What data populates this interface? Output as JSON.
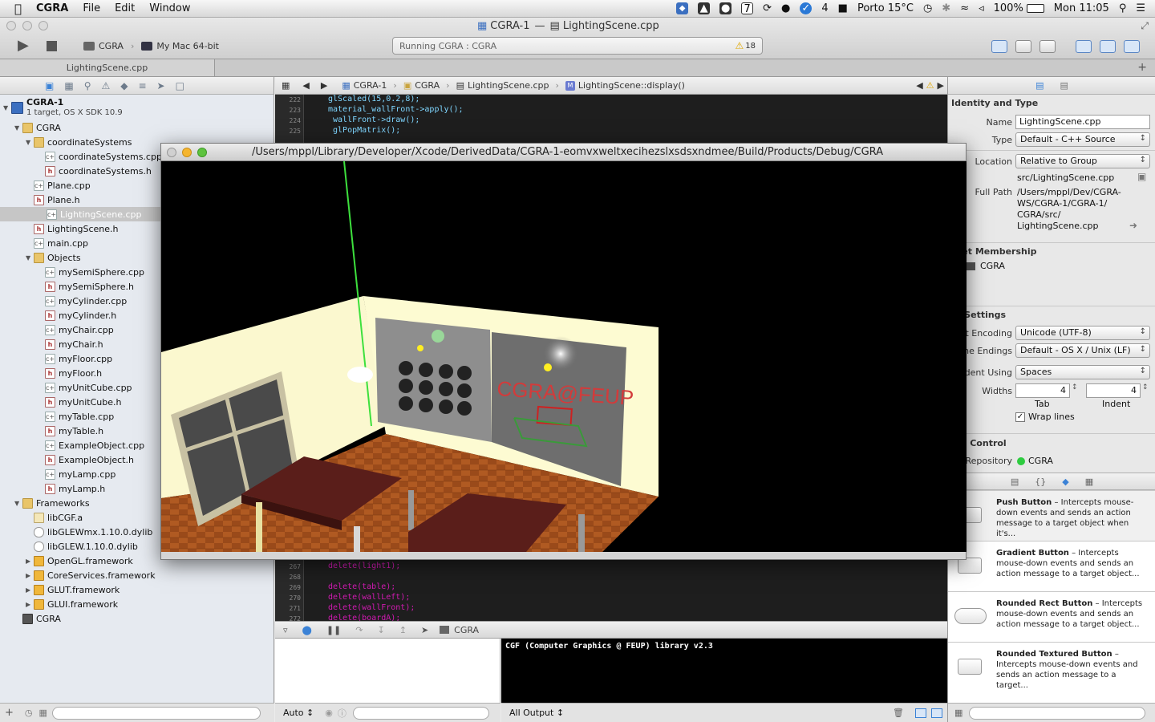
{
  "menubar": {
    "app_name": "CGRA",
    "menus": [
      "File",
      "Edit",
      "Window"
    ],
    "status_items": [
      "4",
      "Porto 15°C",
      "100%",
      "Mon 11:05"
    ]
  },
  "toolbar": {
    "scheme": "CGRA",
    "destination": "My Mac 64-bit",
    "status_text": "Running CGRA : CGRA",
    "warning_count": "18",
    "window_title_project": "CGRA-1",
    "window_title_sep": "—",
    "window_title_file": "LightingScene.cpp"
  },
  "tab": {
    "label": "LightingScene.cpp"
  },
  "navigator": {
    "project_name": "CGRA-1",
    "project_sub": "1 target, OS X SDK 10.9",
    "items": [
      {
        "label": "CGRA",
        "icon": "folder"
      },
      {
        "label": "coordinateSystems",
        "icon": "folder"
      },
      {
        "label": "coordinateSystems.cpp",
        "icon": "cpp"
      },
      {
        "label": "coordinateSystems.h",
        "icon": "h"
      },
      {
        "label": "Plane.cpp",
        "icon": "cpp"
      },
      {
        "label": "Plane.h",
        "icon": "h"
      },
      {
        "label": "LightingScene.cpp",
        "icon": "cpp"
      },
      {
        "label": "LightingScene.h",
        "icon": "h"
      },
      {
        "label": "main.cpp",
        "icon": "cpp"
      },
      {
        "label": "Objects",
        "icon": "folder"
      },
      {
        "label": "mySemiSphere.cpp",
        "icon": "cpp"
      },
      {
        "label": "mySemiSphere.h",
        "icon": "h"
      },
      {
        "label": "myCylinder.cpp",
        "icon": "cpp"
      },
      {
        "label": "myCylinder.h",
        "icon": "h"
      },
      {
        "label": "myChair.cpp",
        "icon": "cpp"
      },
      {
        "label": "myChair.h",
        "icon": "h"
      },
      {
        "label": "myFloor.cpp",
        "icon": "cpp"
      },
      {
        "label": "myFloor.h",
        "icon": "h"
      },
      {
        "label": "myUnitCube.cpp",
        "icon": "cpp"
      },
      {
        "label": "myUnitCube.h",
        "icon": "h"
      },
      {
        "label": "myTable.cpp",
        "icon": "cpp"
      },
      {
        "label": "myTable.h",
        "icon": "h"
      },
      {
        "label": "ExampleObject.cpp",
        "icon": "cpp"
      },
      {
        "label": "ExampleObject.h",
        "icon": "h"
      },
      {
        "label": "myLamp.cpp",
        "icon": "cpp"
      },
      {
        "label": "myLamp.h",
        "icon": "h"
      },
      {
        "label": "Frameworks",
        "icon": "folder"
      },
      {
        "label": "libCGF.a",
        "icon": "lib"
      },
      {
        "label": "libGLEWmx.1.10.0.dylib",
        "icon": "dylib"
      },
      {
        "label": "libGLEW.1.10.0.dylib",
        "icon": "dylib"
      },
      {
        "label": "OpenGL.framework",
        "icon": "framework"
      },
      {
        "label": "CoreServices.framework",
        "icon": "framework"
      },
      {
        "label": "GLUT.framework",
        "icon": "framework"
      },
      {
        "label": "GLUI.framework",
        "icon": "framework"
      },
      {
        "label": "CGRA",
        "icon": "app"
      }
    ]
  },
  "jumpbar": {
    "crumbs": [
      "CGRA-1",
      "CGRA",
      "LightingScene.cpp",
      "LightingScene::display()"
    ]
  },
  "code_top": [
    {
      "ln": "222",
      "text": "glScaled(15,0.2,8);"
    },
    {
      "ln": "223",
      "text": "material_wallFront->apply();"
    },
    {
      "ln": "224",
      "text": " wallFront->draw();"
    },
    {
      "ln": "225",
      "text": " glPopMatrix();"
    }
  ],
  "code_bottom": [
    {
      "ln": "267",
      "text": "delete(light1);"
    },
    {
      "ln": "268",
      "text": ""
    },
    {
      "ln": "269",
      "text": "delete(table);"
    },
    {
      "ln": "270",
      "text": "delete(wallLeft);"
    },
    {
      "ln": "271",
      "text": "delete(wallFront);"
    },
    {
      "ln": "272",
      "text": "delete(boardA);"
    }
  ],
  "debug": {
    "target": "CGRA",
    "vars_scope": "Auto",
    "console_scope": "All Output",
    "console_text": "CGF (Computer Graphics @ FEUP) library v2.3"
  },
  "glwindow": {
    "title": "/Users/mppl/Library/Developer/Xcode/DerivedData/CGRA-1-eomvxweltxecihezslxsdsxndmee/Build/Products/Debug/CGRA",
    "board_text": "CGRA@FEUP"
  },
  "inspector": {
    "identity_title": "Identity and Type",
    "name_label": "Name",
    "name_value": "LightingScene.cpp",
    "type_label": "Type",
    "type_value": "Default - C++ Source",
    "location_label": "Location",
    "location_value": "Relative to Group",
    "location_path": "src/LightingScene.cpp",
    "fullpath_label": "Full Path",
    "fullpath_lines": [
      "/Users/mppl/Dev/CGRA-",
      "WS/CGRA-1/CGRA-1/",
      "CGRA/src/",
      "LightingScene.cpp"
    ],
    "target_title": "rget Membership",
    "target_item": "CGRA",
    "text_title": "xt Settings",
    "encoding_label": "ext Encoding",
    "encoding_value": "Unicode (UTF-8)",
    "endings_label": "ine Endings",
    "endings_value": "Default - OS X / Unix (LF)",
    "indent_label": "ndent Using",
    "indent_value": "Spaces",
    "widths_label": "Widths",
    "tab_value": "4",
    "indent_width_value": "4",
    "tab_caption": "Tab",
    "indent_caption": "Indent",
    "wrap_label": "Wrap lines",
    "source_title": "rce Control",
    "repo_label": "Repository",
    "repo_value": "CGRA"
  },
  "library": [
    {
      "title": "Push Button",
      "desc": " – Intercepts mouse-down events and sends an action message to a target object when it's..."
    },
    {
      "title": "Gradient Button",
      "desc": " – Intercepts mouse-down events and sends an action message to a target object..."
    },
    {
      "title": "Rounded Rect Button",
      "desc": " – Intercepts mouse-down events and sends an action message to a target object..."
    },
    {
      "title": "Rounded Textured Button",
      "desc": " – Intercepts mouse-down events and sends an action message to a target..."
    }
  ],
  "colors": {
    "accent": "#3b82d6",
    "repo_status": "#2ecc40",
    "keyword": "#d11ab2",
    "function": "#7fd6ff"
  }
}
